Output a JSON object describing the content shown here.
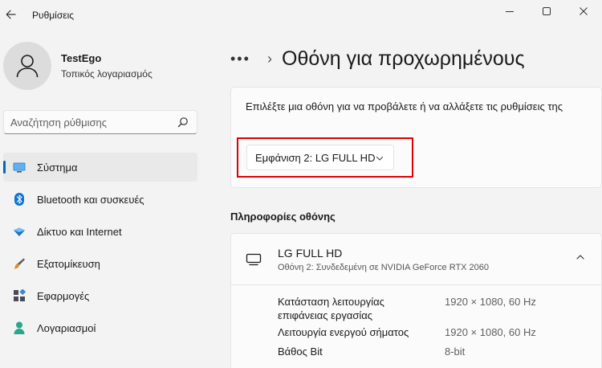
{
  "titlebar": {
    "app_title": "Ρυθμίσεις",
    "back_icon": "back-arrow-icon"
  },
  "profile": {
    "name": "TestEgo",
    "account_type": "Τοπικός λογαριασμός"
  },
  "search": {
    "placeholder": "Αναζήτηση ρύθμισης"
  },
  "nav": {
    "items": [
      {
        "label": "Σύστημα",
        "icon": "system-icon",
        "active": true
      },
      {
        "label": "Bluetooth και συσκευές",
        "icon": "bluetooth-icon"
      },
      {
        "label": "Δίκτυο και Internet",
        "icon": "network-icon"
      },
      {
        "label": "Εξατομίκευση",
        "icon": "personalization-icon"
      },
      {
        "label": "Εφαρμογές",
        "icon": "apps-icon"
      },
      {
        "label": "Λογαριασμοί",
        "icon": "accounts-icon"
      }
    ]
  },
  "breadcrumb": {
    "dots": "•••",
    "separator": "›",
    "title": "Οθόνη για προχωρημένους"
  },
  "select_card": {
    "description": "Επιλέξτε μια οθόνη για να προβάλετε ή να αλλάξετε τις ρυθμίσεις της",
    "dropdown_value": "Εμφάνιση 2: LG FULL HD"
  },
  "info_section": {
    "title": "Πληροφορίες οθόνης",
    "display_name": "LG FULL HD",
    "display_sub": "Οθόνη 2: Συνδεδεμένη σε NVIDIA GeForce RTX 2060",
    "properties": [
      {
        "label": "Κατάσταση λειτουργίας επιφάνειας εργασίας",
        "value": "1920 × 1080, 60 Hz"
      },
      {
        "label": "Λειτουργία ενεργού σήματος",
        "value": "1920 × 1080, 60 Hz"
      },
      {
        "label": "Βάθος Bit",
        "value": "8-bit"
      }
    ]
  },
  "colors": {
    "accent": "#0067c0",
    "highlight": "#e00000",
    "background": "#f3f3f3"
  }
}
